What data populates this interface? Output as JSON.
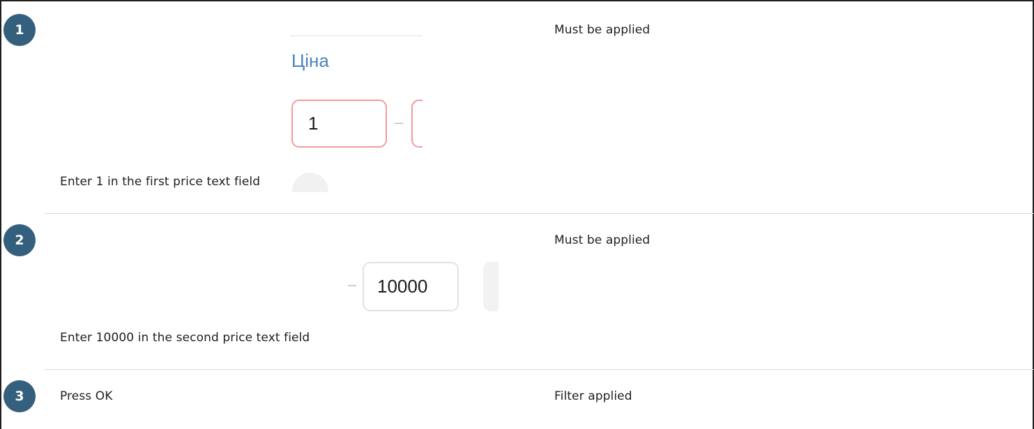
{
  "steps": [
    {
      "number": "1",
      "action": "Enter 1 in the first price text field",
      "expected": "Must be applied",
      "screenshot": {
        "label": "Ціна",
        "min_value": "1",
        "separator": "–"
      }
    },
    {
      "number": "2",
      "action": "Enter 10000 in the second price text field",
      "expected": "Must be applied",
      "screenshot": {
        "separator": "–",
        "max_value": "10000"
      }
    },
    {
      "number": "3",
      "action": "Press OK",
      "expected": "Filter applied"
    }
  ],
  "colors": {
    "badge": "#34607e",
    "price_label": "#4a86bc",
    "error_border": "#f19a9e",
    "divider": "#d6d6d6"
  }
}
